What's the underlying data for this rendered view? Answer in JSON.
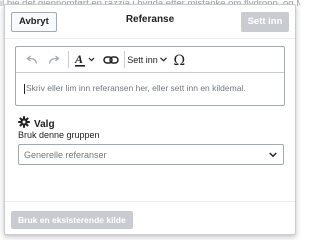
{
  "background": {
    "text": "il bie det gjennomført en razzia i bygda etter mistanke om flydropp, og Milorg-lederen"
  },
  "dialog": {
    "cancel_label": "Avbryt",
    "title": "Referanse",
    "insert_label": "Sett inn"
  },
  "toolbar": {
    "undo_icon": "undo-icon",
    "redo_icon": "redo-icon",
    "text_style_icon": "text-style-icon",
    "link_icon": "link-icon",
    "insert_menu_label": "Sett inn",
    "special_char_icon": "omega-icon"
  },
  "editor": {
    "placeholder": "Skriv eller lim inn referansen her, eller sett inn en kildemal."
  },
  "options": {
    "title": "Valg",
    "group_label": "Bruk denne gruppen",
    "group_placeholder": "Generelle referanser"
  },
  "footer": {
    "use_existing_label": "Bruk en eksisterende kilde"
  },
  "colors": {
    "disabled_button": "#c8ccd1",
    "border": "#a2a9b1",
    "placeholder_text": "#72777d"
  }
}
